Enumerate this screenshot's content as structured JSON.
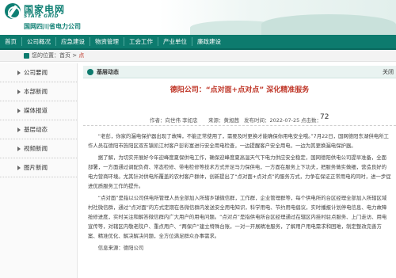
{
  "header": {
    "logo_cn": "国家电网",
    "logo_en": "STATE GRID",
    "company": "国网四川省电力公司"
  },
  "nav": {
    "items": [
      "首页",
      "公司概况",
      "应急建设",
      "物资管理",
      "工会工作",
      "产业单位",
      "廉政建设"
    ]
  },
  "breadcrumb": {
    "prefix": "您的位置：",
    "home": "首页",
    "sep": " > ",
    "current": "点"
  },
  "sidebar": {
    "items": [
      "公司要闻",
      "本部新闻",
      "媒体报道",
      "基层动态",
      "视频新闻",
      "图片新闻"
    ]
  },
  "section": {
    "title": "基层动态",
    "back": "关闭"
  },
  "article": {
    "title": "德阳公司：“点对面+点对点” 深化精准服务",
    "author": "作者：向世伟 李如忠",
    "source": "来源：黄旭茜",
    "date": "发布时间：2022-07-25",
    "views_label": "点击数：",
    "views": "72",
    "paragraphs": [
      "“老彭，你家的漏电保护器出现了故障，不能正常使用了，需要及时更换才能确保你用电安全哦。”7月22日，国网德阳东湖供电所工作人员在德阳市旌阳区双东镇凯江村客户彭彩富进行安全用电检查，一边提醒客户安全用电，一边为其更换漏电保护器。",
      "据了解，为切实开展好今年迎峰度夏保供电工作，确保迎峰度夏高温天气下电力供应安全稳定，国网德阳供电公司提早准备，全面部署，一方面通过调配负荷、常态检修、带电检修等技术方式开足马力保供电，一方面在服务上下功夫，把服务做实做细，营造良好的电力营商环境。尤其针对供电所覆盖的农村客户群体，创新提出了“点对面+点对点”的服务方式，力争在保证正常用电的同时，进一步促进优质服务工作的提升。",
      "“点对面”是指以公司供电所管理人员全部加入所辖乡镇微信群，工作群，企业管理群等，每个供电所的台区经理全部加入所辖区域村社微信群，通过“点对面”的方式定期在各微信群内发送安全用电知识，科学用电、节约用电倡议，实时播报计划停电信息、电力故障抢修进度，实时关注和解答微信群内广大用户的用电问题。“点对点”是指供电所台区经理通过在辖区内挂村驻点服务、上门走访、用电宣传等，对辖区内敬老院户、重点用户、“两保户”建立特殊台账，一对一开展精准服务，了解用户用电需求和困难，制定整改完善方案、精准优化、解决解决问题，全方位满足群众办事需求。"
    ],
    "info_label": "信息来源：德阳公司"
  },
  "colors": {
    "brand": "#0d7b6e",
    "title_red": "#c0392b"
  }
}
